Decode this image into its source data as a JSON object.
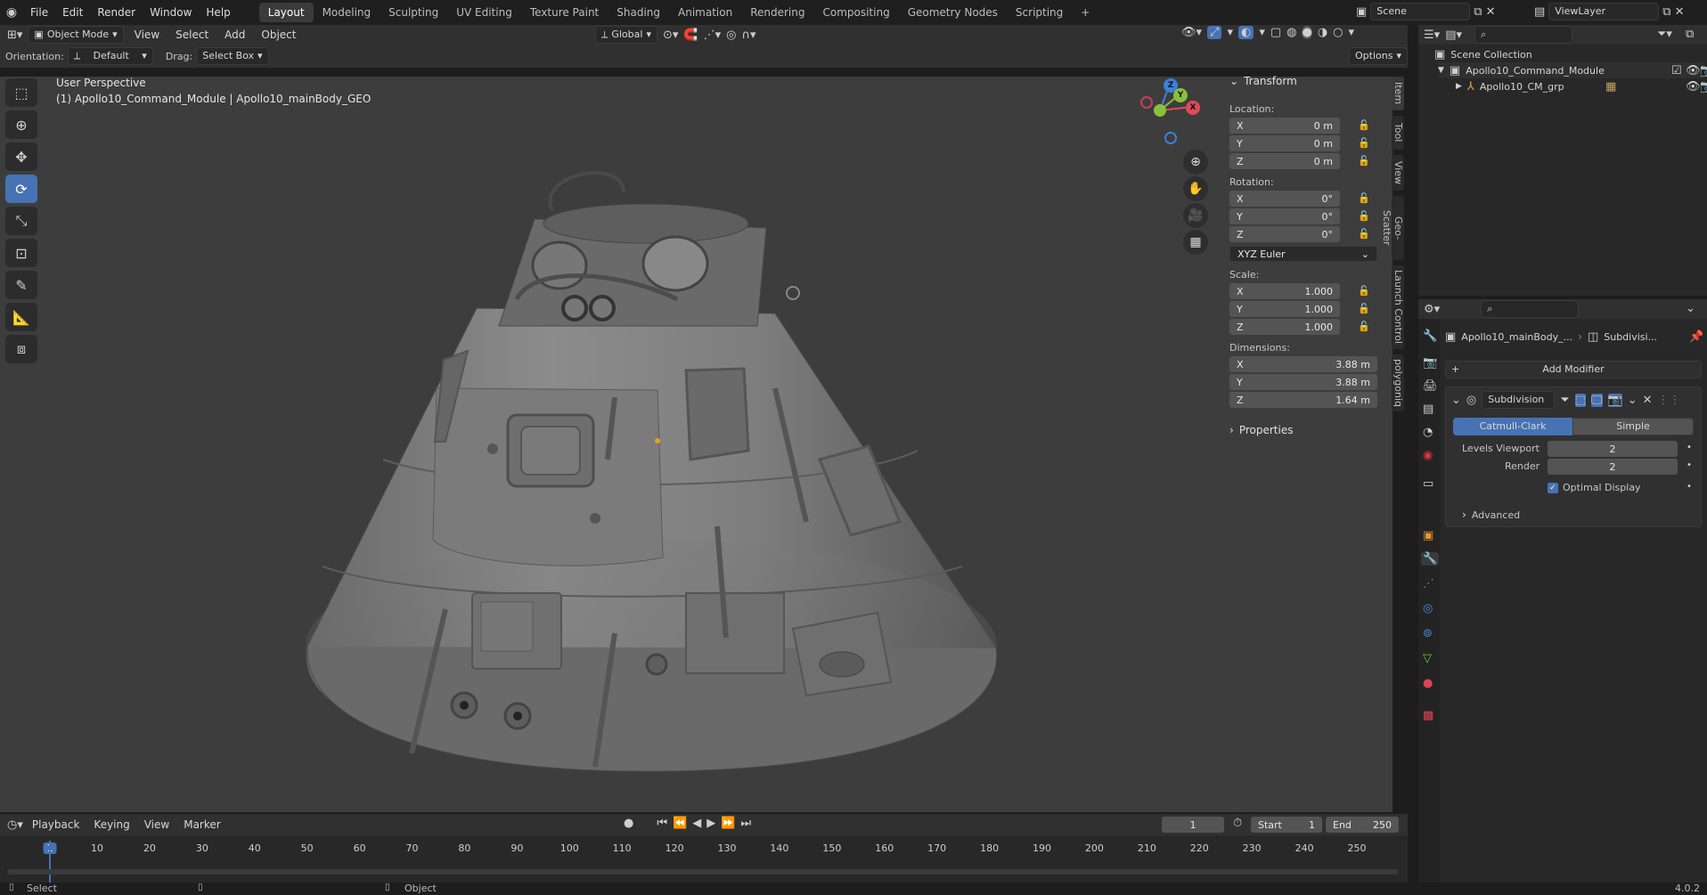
{
  "topbar": {
    "menus": [
      "File",
      "Edit",
      "Render",
      "Window",
      "Help"
    ],
    "workspaces": [
      "Layout",
      "Modeling",
      "Sculpting",
      "UV Editing",
      "Texture Paint",
      "Shading",
      "Animation",
      "Rendering",
      "Compositing",
      "Geometry Nodes",
      "Scripting"
    ],
    "active_workspace": "Layout",
    "add_tab": "+",
    "scene": "Scene",
    "view_layer": "ViewLayer"
  },
  "view3d_header": {
    "mode": "Object Mode",
    "menus": [
      "View",
      "Select",
      "Add",
      "Object"
    ],
    "orientation": "Global"
  },
  "tool_settings": {
    "orientation_label": "Orientation:",
    "orientation_value": "Default",
    "drag_label": "Drag:",
    "drag_value": "Select Box",
    "options": "Options"
  },
  "viewport": {
    "perspective": "User Perspective",
    "object_info": "(1) Apollo10_Command_Module | Apollo10_mainBody_GEO",
    "gizmo_axes": [
      "X",
      "Y",
      "Z"
    ]
  },
  "npanel": {
    "transform": "Transform",
    "location_label": "Location:",
    "location": [
      {
        "axis": "X",
        "value": "0 m"
      },
      {
        "axis": "Y",
        "value": "0 m"
      },
      {
        "axis": "Z",
        "value": "0 m"
      }
    ],
    "rotation_label": "Rotation:",
    "rotation": [
      {
        "axis": "X",
        "value": "0°"
      },
      {
        "axis": "Y",
        "value": "0°"
      },
      {
        "axis": "Z",
        "value": "0°"
      }
    ],
    "rotation_mode": "XYZ Euler",
    "scale_label": "Scale:",
    "scale": [
      {
        "axis": "X",
        "value": "1.000"
      },
      {
        "axis": "Y",
        "value": "1.000"
      },
      {
        "axis": "Z",
        "value": "1.000"
      }
    ],
    "dimensions_label": "Dimensions:",
    "dimensions": [
      {
        "axis": "X",
        "value": "3.88 m"
      },
      {
        "axis": "Y",
        "value": "3.88 m"
      },
      {
        "axis": "Z",
        "value": "1.64 m"
      }
    ],
    "properties": "Properties",
    "tabs": [
      "Item",
      "Tool",
      "View",
      "Geo-Scatter",
      "Launch Control",
      "polygoniq"
    ]
  },
  "outliner": {
    "root": "Scene Collection",
    "items": [
      {
        "label": "Apollo10_Command_Module"
      },
      {
        "label": "Apollo10_CM_grp"
      }
    ]
  },
  "properties": {
    "breadcrumb_object": "Apollo10_mainBody_...",
    "breadcrumb_modifier": "Subdivisi...",
    "add_modifier": "Add Modifier",
    "modifier_name": "Subdivision",
    "mode_catmull": "Catmull-Clark",
    "mode_simple": "Simple",
    "levels_viewport_label": "Levels Viewport",
    "levels_viewport_value": "2",
    "render_label": "Render",
    "render_value": "2",
    "optimal_display": "Optimal Display",
    "advanced": "Advanced"
  },
  "timeline": {
    "menus": [
      "Playback",
      "Keying",
      "View",
      "Marker"
    ],
    "current_frame": "1",
    "start_label": "Start",
    "start_value": "1",
    "end_label": "End",
    "end_value": "250",
    "ticks": [
      "1",
      "10",
      "20",
      "30",
      "40",
      "50",
      "60",
      "70",
      "80",
      "90",
      "100",
      "110",
      "120",
      "130",
      "140",
      "150",
      "160",
      "170",
      "180",
      "190",
      "200",
      "210",
      "220",
      "230",
      "240",
      "250"
    ]
  },
  "status": {
    "select": "Select",
    "object": "Object",
    "version": "4.0.2"
  },
  "colors": {
    "accent": "#4772b3",
    "viewport_bg": "#3d3d3d",
    "panel_bg": "#282828",
    "axis_x": "#e04a5a",
    "axis_y": "#8bbf3a",
    "axis_z": "#3d7fd9"
  }
}
